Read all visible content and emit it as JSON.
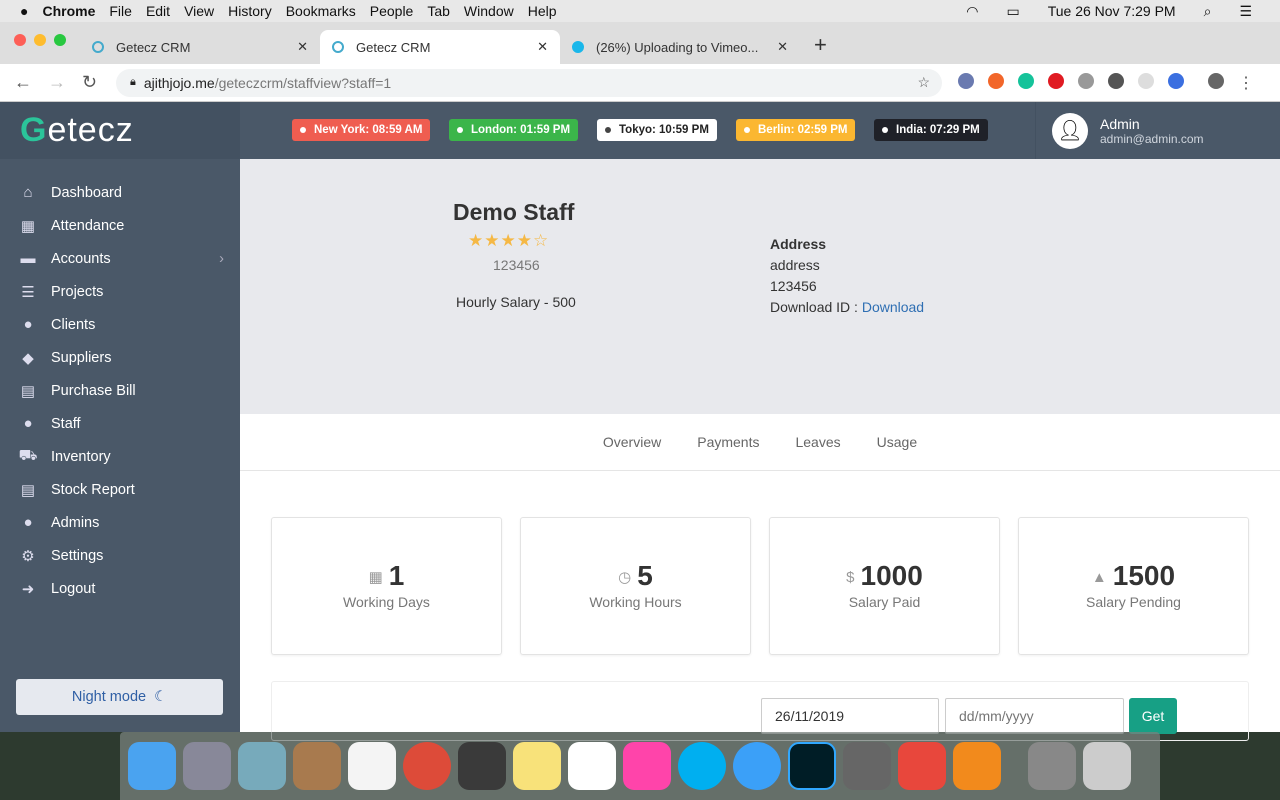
{
  "menubar": {
    "app": "Chrome",
    "items": [
      "File",
      "Edit",
      "View",
      "History",
      "Bookmarks",
      "People",
      "Tab",
      "Window",
      "Help"
    ],
    "clock": "Tue 26 Nov  7:29 PM"
  },
  "browser": {
    "tabs": [
      {
        "title": "Getecz CRM"
      },
      {
        "title": "Getecz CRM"
      },
      {
        "title": "(26%) Uploading to Vimeo..."
      }
    ],
    "url_host": "ajithjojo.me",
    "url_path": "/geteczcrm/staffview?staff=1"
  },
  "sidebar": {
    "logo": "Getecz",
    "items": [
      {
        "label": "Dashboard",
        "icon": "home-icon",
        "glyph": "⌂"
      },
      {
        "label": "Attendance",
        "icon": "calendar-icon",
        "glyph": "▦"
      },
      {
        "label": "Accounts",
        "icon": "briefcase-icon",
        "glyph": "▬",
        "chevron": "›"
      },
      {
        "label": "Projects",
        "icon": "list-icon",
        "glyph": "☰"
      },
      {
        "label": "Clients",
        "icon": "user-icon",
        "glyph": "●"
      },
      {
        "label": "Suppliers",
        "icon": "tags-icon",
        "glyph": "◆"
      },
      {
        "label": "Purchase Bill",
        "icon": "list-alt-icon",
        "glyph": "▤"
      },
      {
        "label": "Staff",
        "icon": "user-icon",
        "glyph": "●"
      },
      {
        "label": "Inventory",
        "icon": "cart-icon",
        "glyph": "⛟"
      },
      {
        "label": "Stock Report",
        "icon": "list-alt-icon",
        "glyph": "▤"
      },
      {
        "label": "Admins",
        "icon": "user-icon",
        "glyph": "●"
      },
      {
        "label": "Settings",
        "icon": "gear-icon",
        "glyph": "⚙"
      },
      {
        "label": "Logout",
        "icon": "sign-out-icon",
        "glyph": "➜"
      }
    ],
    "night_mode": "Night mode"
  },
  "clocks": [
    {
      "label": "New York: 08:59 AM",
      "bg": "#ef5d50",
      "fg": "#ffffff",
      "dot": "#ffffff"
    },
    {
      "label": "London: 01:59 PM",
      "bg": "#3bb54a",
      "fg": "#ffffff",
      "dot": "#ffffff"
    },
    {
      "label": "Tokyo: 10:59 PM",
      "bg": "#ffffff",
      "fg": "#222222",
      "dot": "#444444"
    },
    {
      "label": "Berlin: 02:59 PM",
      "bg": "#fbb731",
      "fg": "#ffffff",
      "dot": "#ffffff"
    },
    {
      "label": "India: 07:29 PM",
      "bg": "#1f2128",
      "fg": "#ffffff",
      "dot": "#ffffff"
    }
  ],
  "user": {
    "name": "Admin",
    "email": "admin@admin.com"
  },
  "profile": {
    "name": "Demo Staff",
    "rating": 4,
    "rating_max": 5,
    "id": "123456",
    "hourly_salary": "Hourly Salary - 500",
    "address_label": "Address",
    "address": "address",
    "address_zip": "123456",
    "download_label": "Download ID : ",
    "download_link": "Download"
  },
  "tabs": [
    "Overview",
    "Payments",
    "Leaves",
    "Usage"
  ],
  "stats": [
    {
      "value": "1",
      "label": "Working Days",
      "icon": "calculator-icon",
      "glyph": "▦"
    },
    {
      "value": "5",
      "label": "Working Hours",
      "icon": "clock-icon",
      "glyph": "◷"
    },
    {
      "value": "1000",
      "label": "Salary Paid",
      "icon": "dollar-icon",
      "glyph": "$"
    },
    {
      "value": "1500",
      "label": "Salary Pending",
      "icon": "warning-icon",
      "glyph": "▲"
    }
  ],
  "filter": {
    "from": "26/11/2019",
    "to_placeholder": "dd/mm/yyyy",
    "button": "Get"
  },
  "accent": "#17a085"
}
